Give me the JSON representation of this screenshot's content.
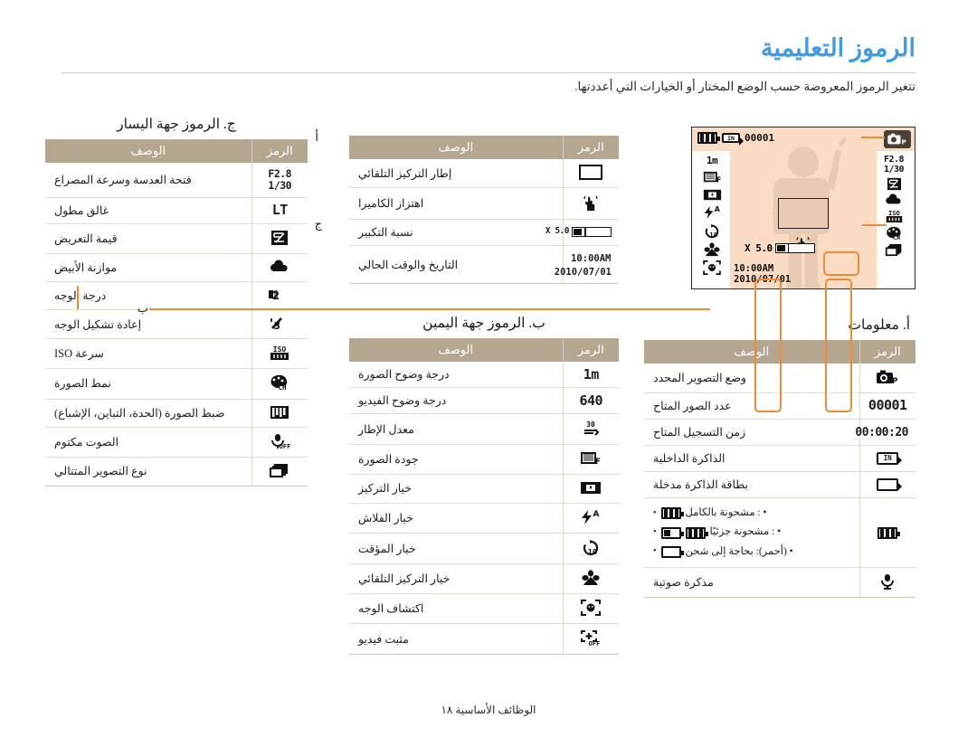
{
  "page": {
    "title": "الرموز التعليمية",
    "intro": "تتغير الرموز المعروضة حسب الوضع المختار أو الخيارات التي أعددتها.",
    "footer": "الوظائف الأساسية ١٨",
    "title_color": "#3d9be9",
    "table_header_color": "#b4a68f",
    "callout_color": "#f28b35",
    "lcd_background": "#f9dcc3"
  },
  "labels": {
    "a": "أ",
    "b": "ب",
    "c": "ج"
  },
  "common": {
    "col_symbol": "الرمز",
    "col_description": "الوصف"
  },
  "table_info": {
    "title": "أ. معلومات",
    "rows": [
      {
        "symbol": "camera-p-icon",
        "symbol_text": "P",
        "description": "وضع التصوير المحدد"
      },
      {
        "symbol": "shots-remaining",
        "symbol_text": "00001",
        "description": "عدد الصور المتاح"
      },
      {
        "symbol": "record-time",
        "symbol_text": "00:00:20",
        "description": "زمن التسجيل المتاح"
      },
      {
        "symbol": "internal-memory-icon",
        "symbol_text": "IN",
        "description": "الذاكرة الداخلية"
      },
      {
        "symbol": "memory-card-icon",
        "symbol_text": "",
        "description": "بطاقة الذاكرة مدخلة"
      },
      {
        "symbol": "battery-icon",
        "symbol_text": "",
        "description": "",
        "battery_states": [
          "• : مشحونة بالكامل",
          "• : مشحونة جزئيًا",
          "• (أحمر): بحاجة إلى شحن"
        ]
      },
      {
        "symbol": "voice-memo-icon",
        "symbol_text": "",
        "description": "مذكرة صوتية"
      }
    ]
  },
  "table_right": {
    "title": "ب. الرموز جهة اليمين",
    "rows": [
      {
        "symbol": "photo-resolution-icon",
        "symbol_text": "1m",
        "description": "درجة وضوح الصورة"
      },
      {
        "symbol": "video-resolution-icon",
        "symbol_text": "640",
        "description": "درجة وضوح الفيديو"
      },
      {
        "symbol": "frame-rate-icon",
        "symbol_text": "30F",
        "description": "معدل الإطار"
      },
      {
        "symbol": "photo-quality-icon",
        "symbol_text": "F",
        "description": "جودة الصورة"
      },
      {
        "symbol": "metering-option-icon",
        "symbol_text": "",
        "description": "خيار التركيز"
      },
      {
        "symbol": "flash-option-icon",
        "symbol_text": "A",
        "description": "خيار الفلاش"
      },
      {
        "symbol": "timer-option-icon",
        "symbol_text": "10",
        "description": "خيار المؤقت"
      },
      {
        "symbol": "macro-focus-icon",
        "symbol_text": "",
        "description": "خيار التركيز التلقائي"
      },
      {
        "symbol": "face-detection-icon",
        "symbol_text": "",
        "description": "اكتشاف الوجه"
      },
      {
        "symbol": "video-stabilizer-off-icon",
        "symbol_text": "OFF",
        "description": "مثبت فيديو"
      }
    ]
  },
  "table_center": {
    "title": "",
    "rows": [
      {
        "symbol": "af-frame-icon",
        "symbol_text": "",
        "description": "إطار التركيز التلقائي"
      },
      {
        "symbol": "camera-shake-icon",
        "symbol_text": "",
        "description": "اهتزاز الكاميرا"
      },
      {
        "symbol": "zoom-ratio-icon",
        "symbol_text": "X 5.0",
        "description": "نسبة التكبير"
      },
      {
        "symbol": "date-time-icon",
        "symbol_text_1": "10:00AM",
        "symbol_text_2": "2010/07/01",
        "description": "التاريخ والوقت الحالي"
      }
    ]
  },
  "table_left": {
    "title": "ج. الرموز جهة اليسار",
    "rows": [
      {
        "symbol": "aperture-shutter-icon",
        "symbol_text_1": "F2.8",
        "symbol_text_2": "1/30",
        "description": "فتحة العدسة وسرعة المصراع"
      },
      {
        "symbol": "long-time-shutter-icon",
        "symbol_text": "LT",
        "description": "غالق مطول"
      },
      {
        "symbol": "exposure-value-icon",
        "symbol_text": "",
        "description": "قيمة التعريض"
      },
      {
        "symbol": "white-balance-icon",
        "symbol_text": "",
        "description": "موازنة الأبيض"
      },
      {
        "symbol": "face-tone-icon",
        "symbol_text": "",
        "description": "درجة الوجه"
      },
      {
        "symbol": "face-retouch-icon",
        "symbol_text": "",
        "description": "إعادة تشكيل الوجه"
      },
      {
        "symbol": "iso-speed-icon",
        "symbol_text": "ISO",
        "description": "سرعة ISO"
      },
      {
        "symbol": "photo-style-icon",
        "symbol_text": "CH",
        "description": "نمط الصورة"
      },
      {
        "symbol": "image-adjust-icon",
        "symbol_text": "",
        "description": "ضبط الصورة (الحدة، التباين، الإشباع)"
      },
      {
        "symbol": "sound-mute-icon",
        "symbol_text": "OFF",
        "description": "الصوت مكتوم"
      },
      {
        "symbol": "drive-mode-icon",
        "symbol_text": "",
        "description": "نوع التصوير المتتالي"
      }
    ]
  },
  "lcd": {
    "mode": "P",
    "shots_remaining": "00001",
    "memory_badge": "IN",
    "battery": "full",
    "left_column": [
      "F2.8",
      "1/30",
      "exposure-value-icon",
      "white-balance-icon",
      "ISO",
      "photo-style-CH",
      "drive-mode-icon"
    ],
    "right_column": [
      "1m",
      "photo-quality-icon",
      "metering-icon",
      "flash-auto-icon",
      "timer-10-icon",
      "macro-icon",
      "face-detect-icon"
    ],
    "zoom": "X 5.0",
    "time": "10:00AM",
    "date": "2010/07/01"
  }
}
